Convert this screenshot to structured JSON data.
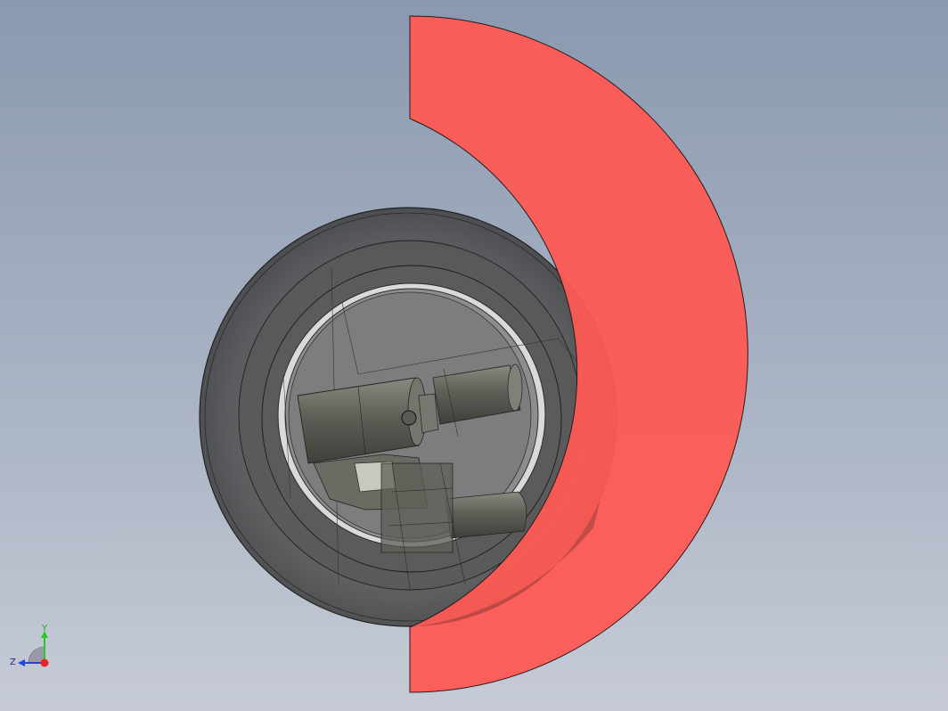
{
  "viewport": {
    "background_top": "#8a99b0",
    "background_bottom": "#c6cbd6"
  },
  "model": {
    "part_ring_color": "#fe5a54",
    "wheel_color": "#4a4a4a",
    "component_color": "#6a6a62"
  },
  "triad": {
    "y_label": "Y",
    "z_label": "Z",
    "y_axis_color": "#22cc22",
    "z_axis_color": "#2244dd",
    "x_axis_color": "#ee2222"
  }
}
